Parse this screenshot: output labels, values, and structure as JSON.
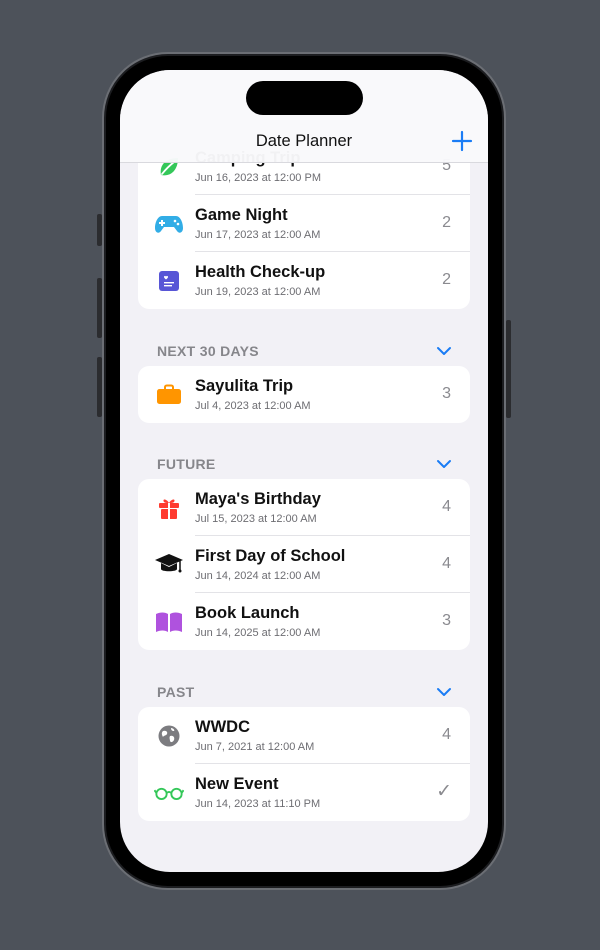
{
  "nav": {
    "title": "Date Planner"
  },
  "top_card": [
    {
      "title": "Camping Trip",
      "date": "Jun 16, 2023 at 12:00 PM",
      "count": "5",
      "icon": "leaf-icon"
    },
    {
      "title": "Game Night",
      "date": "Jun 17, 2023 at 12:00 AM",
      "count": "2",
      "icon": "gamecontroller-icon"
    },
    {
      "title": "Health Check-up",
      "date": "Jun 19, 2023 at 12:00 AM",
      "count": "2",
      "icon": "heart-clipboard-icon"
    }
  ],
  "sections": [
    {
      "label": "NEXT 30 DAYS",
      "items": [
        {
          "title": "Sayulita Trip",
          "date": "Jul 4, 2023 at 12:00 AM",
          "count": "3",
          "icon": "suitcase-icon"
        }
      ]
    },
    {
      "label": "FUTURE",
      "items": [
        {
          "title": "Maya's Birthday",
          "date": "Jul 15, 2023 at 12:00 AM",
          "count": "4",
          "icon": "gift-icon"
        },
        {
          "title": "First Day of School",
          "date": "Jun 14, 2024 at 12:00 AM",
          "count": "4",
          "icon": "graduation-cap-icon"
        },
        {
          "title": "Book Launch",
          "date": "Jun 14, 2025 at 12:00 AM",
          "count": "3",
          "icon": "book-icon"
        }
      ]
    },
    {
      "label": "PAST",
      "items": [
        {
          "title": "WWDC",
          "date": "Jun 7, 2021 at 12:00 AM",
          "count": "4",
          "icon": "globe-icon"
        },
        {
          "title": "New Event",
          "date": "Jun 14, 2023 at 11:10 PM",
          "count": "✓",
          "icon": "eyeglasses-icon"
        }
      ]
    }
  ],
  "colors": {
    "accent": "#1a7cf5",
    "leaf": "#34c759",
    "gamecontroller": "#32ade6",
    "clipboard": "#5856d6",
    "suitcase": "#ff9500",
    "gift": "#ff3b30",
    "book": "#af52de",
    "globe": "#7c7c80",
    "eyeglasses": "#34c759"
  }
}
